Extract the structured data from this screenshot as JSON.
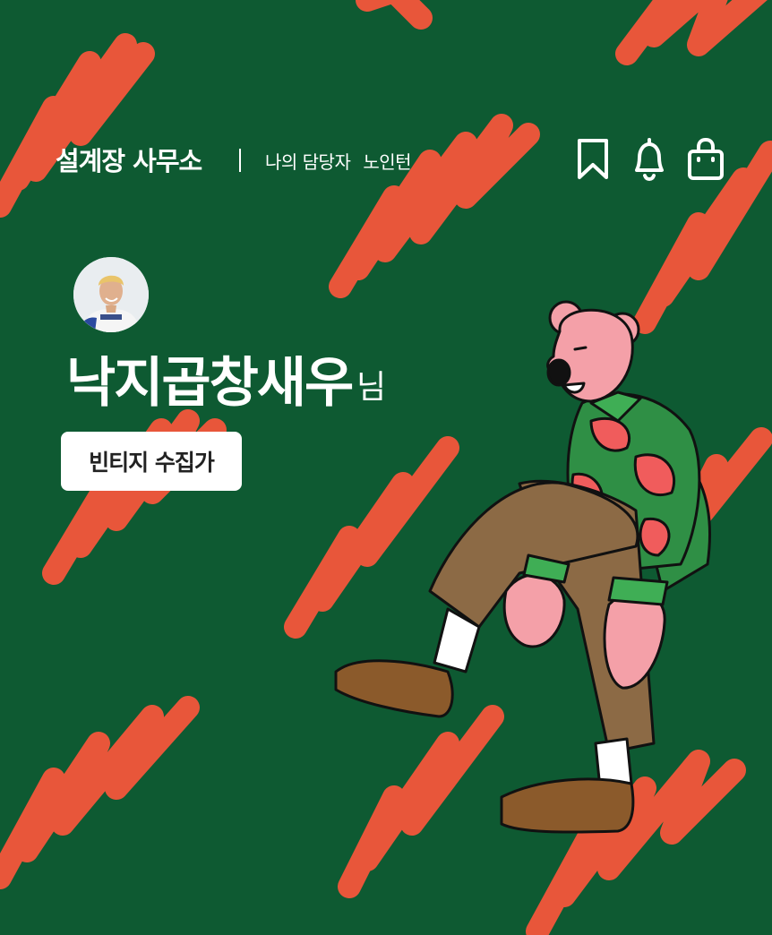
{
  "header": {
    "title": "설계장 사무소",
    "manager_label": "나의 담당자",
    "manager_name": "노인턴"
  },
  "icons": [
    "bookmark-icon",
    "bell-icon",
    "shopping-bag-icon"
  ],
  "profile": {
    "nickname": "낙지곱창새우",
    "honorific": "님",
    "badge": "빈티지 수집가"
  },
  "colors": {
    "background": "#0e5a32",
    "scribble": "#e8563a",
    "white": "#ffffff"
  }
}
